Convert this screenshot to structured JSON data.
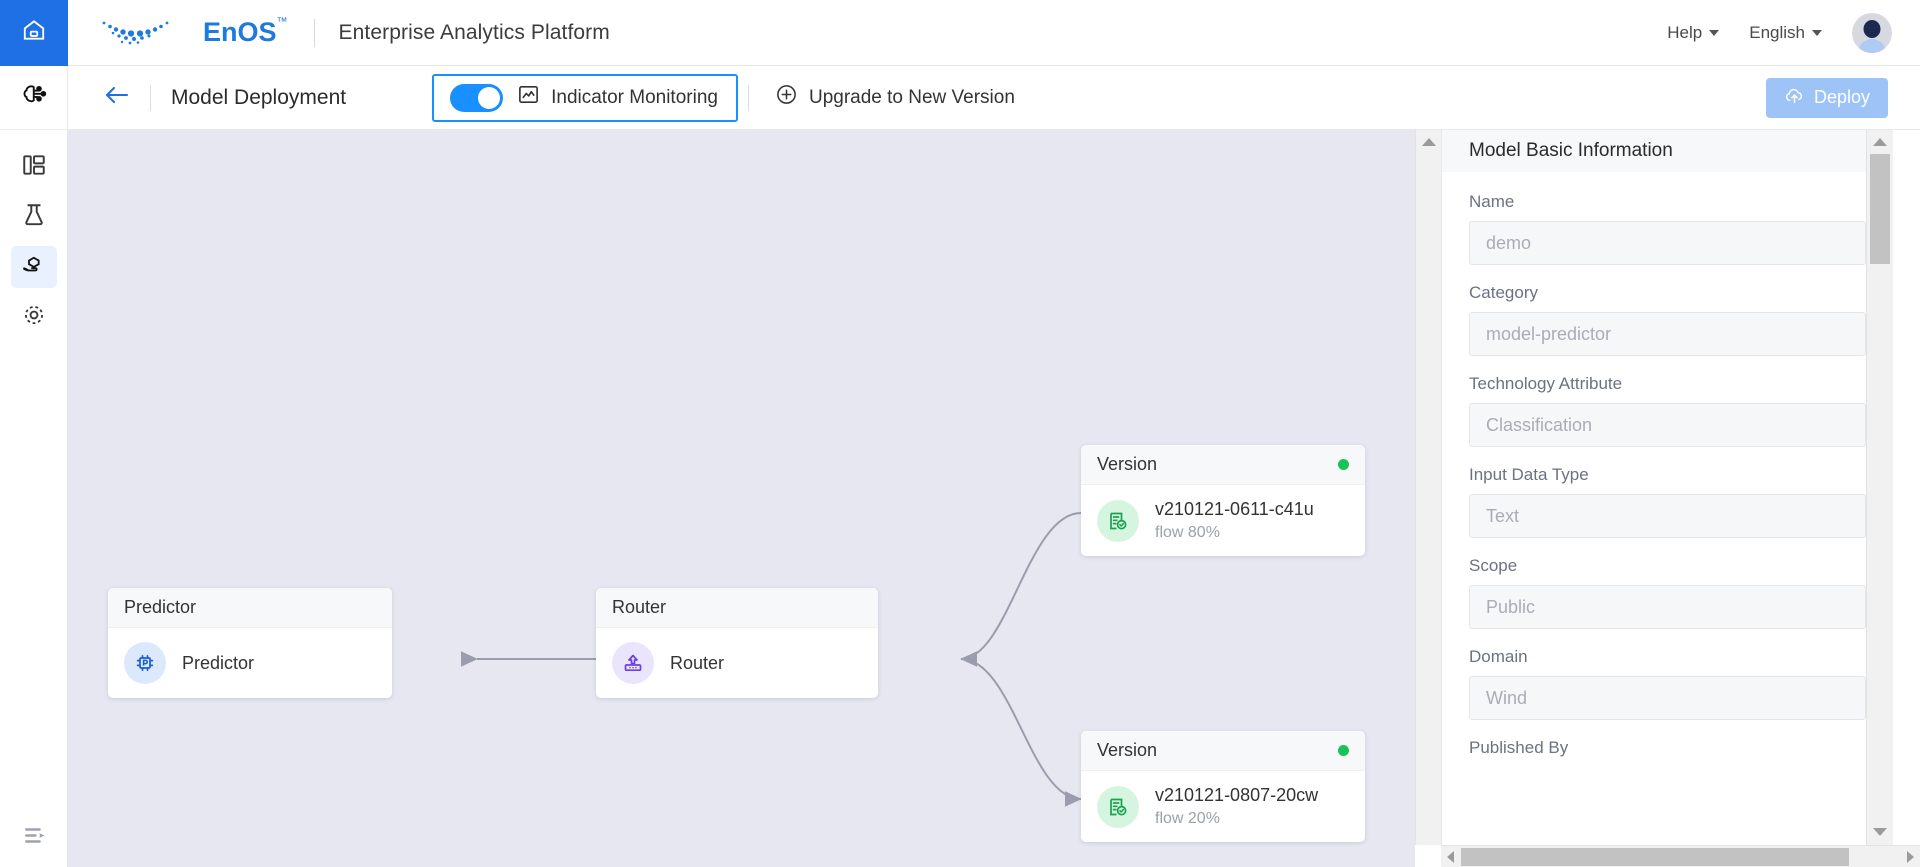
{
  "topbar": {
    "home_icon": "home-icon",
    "logo_text": "EnOS",
    "logo_tm": "™",
    "platform_title": "Enterprise Analytics Platform",
    "help_label": "Help",
    "language_label": "English",
    "avatar": "user-avatar"
  },
  "sidebar": {
    "logo_item": "ai-model-icon",
    "items": [
      {
        "name": "dashboard",
        "icon": "dashboard-layout-icon",
        "active": false
      },
      {
        "name": "lab",
        "icon": "flask-icon",
        "active": false
      },
      {
        "name": "model-deployment",
        "icon": "hand-cube-icon",
        "active": true
      },
      {
        "name": "settings",
        "icon": "target-settings-icon",
        "active": false
      }
    ],
    "collapse_toggle": "expand-sidebar-icon"
  },
  "toolbar": {
    "back_icon": "back-arrow-icon",
    "page_title": "Model Deployment",
    "toggle_on": true,
    "indicator_icon": "chart-monitor-icon",
    "indicator_label": "Indicator  Monitoring",
    "upgrade_icon": "plus-circle-icon",
    "upgrade_label": "Upgrade  to  New  Version",
    "deploy_icon": "cloud-upload-icon",
    "deploy_label": "Deploy",
    "highlight_color": "#1890ff"
  },
  "diagram": {
    "background": "#e6e7f0",
    "nodes": [
      {
        "id": "predictor",
        "header": "Predictor",
        "title": "Predictor",
        "subtitle": "",
        "icon": "predictor-chip-icon",
        "badge_style": "badge-blue",
        "status": null
      },
      {
        "id": "router",
        "header": "Router",
        "title": "Router",
        "subtitle": "",
        "icon": "router-icon",
        "badge_style": "badge-purple",
        "status": null
      },
      {
        "id": "version-top",
        "header": "Version",
        "title": "v210121-0611-c41u",
        "subtitle": "flow 80%",
        "icon": "document-check-icon",
        "badge_style": "badge-green",
        "status": "#19c257"
      },
      {
        "id": "version-bottom",
        "header": "Version",
        "title": "v210121-0807-20cw",
        "subtitle": "flow 20%",
        "icon": "document-check-icon",
        "badge_style": "badge-green",
        "status": "#19c257"
      }
    ]
  },
  "panel": {
    "header": "Model Basic Information",
    "fields": [
      {
        "label": "Name",
        "value": "demo"
      },
      {
        "label": "Category",
        "value": "model-predictor"
      },
      {
        "label": "Technology Attribute",
        "value": "Classification"
      },
      {
        "label": "Input Data Type",
        "value": "Text"
      },
      {
        "label": "Scope",
        "value": "Public"
      },
      {
        "label": "Domain",
        "value": "Wind"
      },
      {
        "label": "Published By",
        "value": ""
      }
    ]
  }
}
